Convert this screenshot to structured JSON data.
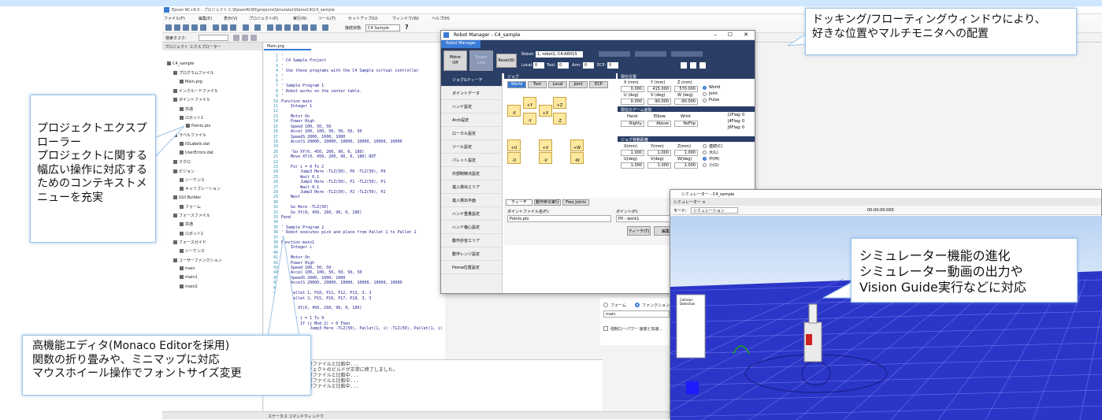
{
  "ide": {
    "title": "Epson RC+8.0 - プロジェクト C:\\EpsonRC80\\projects\\Simulator\\DemoC4\\C4_sample",
    "menu": [
      "ファイル(F)",
      "編集(E)",
      "表示(V)",
      "プロジェクト(P)",
      "実行(R)",
      "ツール(T)",
      "セットアップ(U)",
      "ウィンドウ(W)",
      "ヘルプ(H)"
    ],
    "connection_label": "接続状態:",
    "connection_value": "C4 Sample",
    "search_placeholder": "検索タスク:",
    "explorer_title": "プロジェクト エクスプローラー",
    "tree": [
      "C4_sample",
      "プログラムファイル",
      "Main.prg",
      "インクルードファイル",
      "ポイントファイル",
      "共通",
      "ロボット1",
      "Points.pts",
      "ラベルファイル",
      "IOLabels.dat",
      "UserErrors.dat",
      "マクロ",
      "ビジョン",
      "シーケンス",
      "キャリブレーション",
      "GUI Builder",
      "フォーム",
      "フォースファイル",
      "共通",
      "ロボット1",
      "フォースガイド",
      "シーケンス",
      "ユーザーファンクション",
      "main",
      "main1",
      "main2"
    ],
    "editor_tab": "Main.prg",
    "line_numbers": "1\n2\n3\n4\n5\n6\n7\n8\n9\n10\n11\n12\n13\n14\n15\n16\n17\n18\n19\n20\n21\n22\n23\n24\n25\n26\n27\n28\n29\n30\n31\n32\n33\n34\n35\n36\n37\n38\n39\n40\n41\n42\n43\n44\n45\n46\n47\n48\n49\n50\n51\n52\n53\n54\n55\n56\n57\n58\n59\n60\n61",
    "code": "'\n' C4 Sample Project\n'\n' Use these programs with the C4 Sample virtual controller\n'\n'\n' Sample Program 1\n' Robot works on the center table.\n'\nFunction main\n    Integer 1\n\n    Motor On\n    Power High\n    Speed 100, 50, 50\n    Accel 100, 100, 50, 50, 50, 50\n    SpeedS 2000, 1000, 1000\n    AccelS 20000, 20000, 10000, 10000, 10000, 10000\n\n    'Go XY(0, 450, 260, 90, 0, 180)\n    Move XY(0, 450, 260, 90, 0, 180) ROT\n\n    For i = 0 To 2\n        Jump3 Here -TLZ(50), P0 -TLZ(50), P0\n        Wait 0.1\n        Jump3 Here -TLZ(50), P1 -TLZ(50), P1\n        Wait 0.1\n        Jump3 Here -TLZ(50), P2 -TLZ(50), P2\n    Next\n\n    Go Here -TLZ(50)\n    Go XY(0, 450, 260, 90, 0, 180)\nFend\n\n' Sample Program 2\n' Robot executes pick and place from Pallet 1 to Pallet 2\n'\nFunction main1\n    Integer i\n\n    Motor On\n    Power High\n    Speed 100, 50, 50\n    Accel 100, 100, 50, 50, 50, 50\n    SpeedS 2000, 1000, 1000\n    AccelS 20000, 20000, 10000, 10000, 10000, 10000\n\n    Pallet 1, P10, P11, P12, P13, 3, 3\n    Pallet 2, P15, P16, P17, P18, 3, 3\n\n    Go XY(0, 450, 260, 90, 0, 180)\n\n    For i = 1 To 9\n        If (i Mod 2) > 0 Then\n            Jump3 Here -TLZ(50), Pallet(1, i) -TLZ(50), Pallet(1, i)",
    "output_lines": "[09:00:51] 実行用ファイルと比較中...\n[09:00:51] プロジェクトのビルドが正常に終了しました。\n[09:00:51] 実行用ファイルと比較中...\n[09:00:51] 実行用ファイルと比較中...\n[09:00:51] 実行用ファイルと比較中...",
    "status_tabs": [
      "ステータス",
      "コマンドウィンドウ"
    ]
  },
  "robot_manager": {
    "title": "Robot Manager - C4_sample",
    "tab": "Robot Manager",
    "motor": "Motor\nOff",
    "power": "Power\nLow",
    "reset": "Reset(R)",
    "robot_label": "Robot:",
    "robot_value": "1, robot1, C4-A601S",
    "local_label": "Local:",
    "local_value": "0",
    "tool_label": "Tool:",
    "tool_value": "0",
    "arm_label": "Arm:",
    "arm_value": "0",
    "ecp_label": "ECP:",
    "ecp_value": "0",
    "sidebar": [
      "ジョグ&ティーチ",
      "ポイントデータ",
      "ハンド設定",
      "Arch設定",
      "ローカル設定",
      "ツール設定",
      "パレット設定",
      "外部制御点設定",
      "進入検出エリア",
      "進入検出平面",
      "ハンド重量設定",
      "ハンド偏心設定",
      "動作許容エリア",
      "動作レンジ設定",
      "Home位置設定"
    ],
    "jog_section": "ジョグ",
    "jog_modes": [
      "World",
      "Tool",
      "Local",
      "Joint",
      "ECP"
    ],
    "jog_buttons": [
      "+Y",
      "+Z",
      "-X",
      "+X",
      "-Y",
      "-Z",
      "+U",
      "+V",
      "+W",
      "-U",
      "-V",
      "-W"
    ],
    "pos_section": "現在位置",
    "pos_headers": [
      "X (mm)",
      "Y (mm)",
      "Z (mm)"
    ],
    "pos_values": [
      "0.000",
      "415.000",
      "570.000"
    ],
    "ang_headers": [
      "U (deg)",
      "V (deg)",
      "W (deg)"
    ],
    "ang_values": [
      "0.000",
      "-90.000",
      "-90.000"
    ],
    "coord_options": [
      "World",
      "Joint",
      "Pulse"
    ],
    "arm_section": "現在のアーム姿勢",
    "arm_headers": [
      "Hand",
      "Elbow",
      "Wrist"
    ],
    "arm_values": [
      "Righty",
      "Above",
      "NoFlip"
    ],
    "flags": [
      "J1Flag:",
      "J4Flag:",
      "J6Flag:"
    ],
    "flag_values": [
      "0",
      "0",
      "0"
    ],
    "dist_section": "ジョグ移動距離",
    "dist_headers": [
      "X(mm)",
      "Y(mm)",
      "Z(mm)"
    ],
    "dist_values": [
      "1.000",
      "1.000",
      "1.000"
    ],
    "dist_headers2": [
      "U(deg)",
      "V(deg)",
      "W(deg)"
    ],
    "dist_values2": [
      "1.000",
      "1.000",
      "1.000"
    ],
    "speed_options": [
      "連続(C)",
      "大(L)",
      "中(M)",
      "小(S)"
    ],
    "bottom_tabs": [
      "ティーチ",
      "動作命令実行",
      "Free Joints"
    ],
    "point_file_label": "ポイントファイル名(F):",
    "point_file_value": "Points.pts",
    "point_label": "ポイント(P):",
    "point_value": "P0 - work1",
    "teach_button": "ティーチ(T)",
    "edit_button": "編集"
  },
  "background_panel": {
    "radio1": "フォーム",
    "radio2": "ファンクション",
    "combo": "main",
    "checkbox": "強制ローパワー 速度と加速..."
  },
  "simulator": {
    "title": "シミュレーター - C4_sample",
    "tab": "シミュレーター",
    "mode_label": "モード:",
    "mode_value": "シミュレーション",
    "time": "00:00:00:000",
    "checkbox": "Collision Detection"
  },
  "callouts": {
    "docking": "ドッキング/フローティングウィンドウにより、\n好きな位置やマルチモニタへの配置",
    "explorer": "プロジェクトエクスプ\nローラー\nプロジェクトに関する\n幅広い操作に対応する\nためのコンテキストメ\nニューを充実",
    "simulator": "シミュレーター機能の進化\nシミュレーター動画の出力や\nVision Guide実行などに対応",
    "editor": "高機能エディタ(Monaco Editorを採用)\n関数の折り畳みや、ミニマップに対応\nマウスホイール操作でフォントサイズ変更"
  },
  "colors": {
    "accent": "#2a3e66",
    "highlight": "#3a7bd5",
    "sim_floor": "#2b35c8",
    "callout_border": "#9ec5e8"
  }
}
